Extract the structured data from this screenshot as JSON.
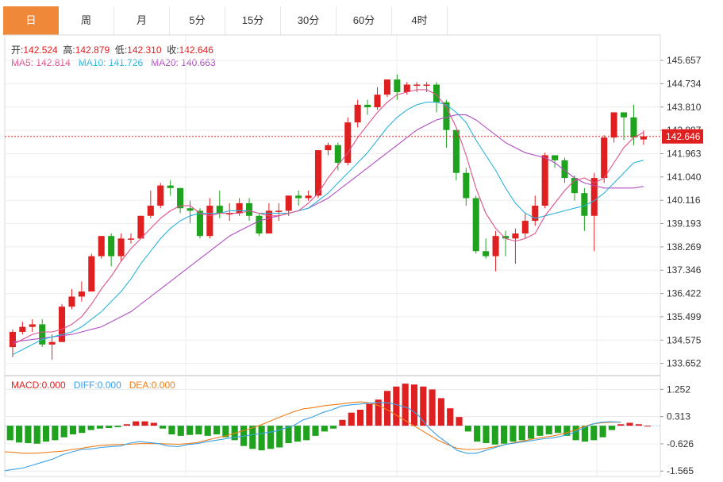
{
  "tabs": [
    {
      "label": "日",
      "active": true
    },
    {
      "label": "周"
    },
    {
      "label": "月"
    },
    {
      "label": "5分"
    },
    {
      "label": "15分"
    },
    {
      "label": "30分"
    },
    {
      "label": "60分"
    },
    {
      "label": "4时"
    }
  ],
  "ohlc_info": {
    "open_label": "开:",
    "open": "142.524",
    "high_label": "高:",
    "high": "142.879",
    "low_label": "低:",
    "low": "142.310",
    "close_label": "收:",
    "close": "142.646"
  },
  "ma_info": {
    "ma5_label": "MA5:",
    "ma5": "142.814",
    "ma10_label": "MA10:",
    "ma10": "141.726",
    "ma20_label": "MA20:",
    "ma20": "140.663"
  },
  "macd_info": {
    "macd_label": "MACD:",
    "macd": "0.000",
    "diff_label": "DIFF:",
    "diff": "0.000",
    "dea_label": "DEA:",
    "dea": "0.000"
  },
  "colors": {
    "up": "#e02020",
    "down": "#1fa31f",
    "ma5": "#e0508c",
    "ma10": "#2ab4d8",
    "ma20": "#b04ec2",
    "diff": "#3aa0e8",
    "dea": "#ef7d1a",
    "grid": "#ececec",
    "price_line": "#e02020"
  },
  "chart_data": [
    {
      "type": "candlestick",
      "ylim": [
        133.2,
        146.1
      ],
      "yticks": [
        "145.657",
        "144.734",
        "143.810",
        "142.887",
        "141.963",
        "141.040",
        "140.116",
        "139.193",
        "138.269",
        "137.346",
        "136.422",
        "135.499",
        "134.575",
        "133.652"
      ],
      "last_price": "142.646",
      "candles": [
        [
          134.3,
          134.9,
          135.0,
          133.9
        ],
        [
          134.9,
          135.1,
          135.3,
          134.8
        ],
        [
          135.1,
          135.2,
          135.4,
          134.9
        ],
        [
          135.2,
          134.4,
          135.4,
          134.3
        ],
        [
          134.4,
          134.5,
          134.8,
          133.8
        ],
        [
          134.5,
          135.9,
          136.0,
          134.5
        ],
        [
          135.9,
          136.3,
          136.6,
          135.8
        ],
        [
          136.3,
          136.5,
          136.9,
          136.1
        ],
        [
          136.5,
          137.9,
          138.0,
          136.5
        ],
        [
          137.9,
          138.7,
          138.7,
          137.8
        ],
        [
          138.7,
          137.9,
          138.8,
          137.5
        ],
        [
          137.9,
          138.6,
          138.8,
          137.7
        ],
        [
          138.6,
          138.6,
          138.8,
          138.4
        ],
        [
          138.6,
          139.5,
          139.5,
          138.6
        ],
        [
          139.5,
          139.9,
          140.5,
          139.4
        ],
        [
          139.9,
          140.7,
          140.8,
          139.8
        ],
        [
          140.7,
          140.6,
          140.9,
          140.3
        ],
        [
          140.6,
          139.8,
          140.6,
          139.6
        ],
        [
          139.8,
          139.7,
          140.1,
          139.2
        ],
        [
          139.7,
          138.7,
          139.8,
          138.6
        ],
        [
          138.7,
          139.9,
          140.2,
          138.6
        ],
        [
          139.9,
          139.6,
          140.5,
          139.4
        ],
        [
          139.6,
          139.6,
          140.0,
          139.3
        ],
        [
          139.6,
          140.0,
          140.2,
          139.5
        ],
        [
          140.0,
          139.5,
          140.2,
          139.3
        ],
        [
          139.5,
          138.8,
          139.6,
          138.7
        ],
        [
          138.8,
          139.7,
          140.0,
          138.8
        ],
        [
          139.7,
          139.7,
          140.0,
          139.3
        ],
        [
          139.7,
          140.3,
          140.3,
          139.5
        ],
        [
          140.3,
          140.2,
          140.5,
          139.9
        ],
        [
          140.2,
          140.3,
          140.5,
          140.1
        ],
        [
          140.3,
          142.1,
          142.1,
          140.2
        ],
        [
          142.1,
          142.3,
          142.4,
          141.9
        ],
        [
          142.3,
          141.6,
          142.4,
          141.3
        ],
        [
          141.6,
          143.2,
          143.4,
          141.5
        ],
        [
          143.2,
          143.9,
          144.1,
          143.0
        ],
        [
          143.9,
          143.8,
          144.1,
          143.5
        ],
        [
          143.8,
          144.3,
          144.6,
          143.7
        ],
        [
          144.3,
          144.9,
          144.9,
          144.2
        ],
        [
          144.9,
          144.4,
          145.1,
          144.1
        ],
        [
          144.4,
          144.7,
          144.8,
          144.3
        ],
        [
          144.7,
          144.7,
          144.8,
          144.4
        ],
        [
          144.7,
          144.7,
          144.8,
          144.4
        ],
        [
          144.7,
          144.0,
          144.8,
          143.6
        ],
        [
          144.0,
          142.9,
          144.1,
          142.2
        ],
        [
          142.9,
          141.2,
          142.9,
          140.9
        ],
        [
          141.2,
          140.2,
          141.4,
          139.9
        ],
        [
          140.2,
          138.1,
          140.3,
          138.0
        ],
        [
          138.1,
          137.9,
          138.6,
          137.8
        ],
        [
          137.9,
          138.7,
          138.9,
          137.3
        ],
        [
          138.7,
          138.6,
          138.9,
          137.9
        ],
        [
          138.6,
          138.8,
          139.0,
          137.6
        ],
        [
          138.8,
          139.3,
          139.6,
          138.6
        ],
        [
          139.3,
          139.9,
          140.3,
          139.1
        ],
        [
          139.9,
          141.9,
          142.0,
          139.8
        ],
        [
          141.9,
          141.7,
          141.9,
          141.4
        ],
        [
          141.7,
          141.0,
          141.8,
          140.8
        ],
        [
          141.0,
          140.4,
          141.1,
          140.1
        ],
        [
          140.4,
          139.5,
          140.6,
          138.9
        ],
        [
          139.5,
          141.0,
          141.2,
          138.1
        ],
        [
          141.0,
          142.6,
          142.7,
          140.8
        ],
        [
          142.6,
          143.6,
          143.6,
          142.4
        ],
        [
          143.6,
          143.4,
          143.6,
          142.5
        ],
        [
          143.4,
          142.6,
          143.9,
          142.3
        ],
        [
          142.524,
          142.646,
          142.879,
          142.31
        ]
      ],
      "ma5": [
        134.4,
        134.6,
        134.8,
        134.9,
        134.9,
        135.0,
        135.2,
        135.5,
        136.0,
        136.6,
        137.1,
        137.7,
        138.2,
        138.6,
        139.0,
        139.4,
        139.7,
        139.9,
        139.9,
        139.6,
        139.5,
        139.6,
        139.6,
        139.6,
        139.7,
        139.6,
        139.5,
        139.5,
        139.6,
        139.7,
        140.0,
        140.4,
        141.0,
        141.5,
        142.0,
        142.6,
        143.1,
        143.6,
        144.0,
        144.3,
        144.4,
        144.5,
        144.5,
        144.3,
        143.8,
        143.0,
        141.9,
        140.6,
        139.6,
        139.0,
        138.6,
        138.5,
        138.6,
        138.8,
        139.5,
        140.0,
        140.5,
        140.9,
        141.0,
        140.8,
        141.0,
        141.6,
        142.2,
        142.6,
        142.8
      ],
      "ma10": [
        134.0,
        134.2,
        134.4,
        134.6,
        134.7,
        134.8,
        134.9,
        135.1,
        135.4,
        135.7,
        136.1,
        136.5,
        137.0,
        137.6,
        138.1,
        138.6,
        139.0,
        139.3,
        139.5,
        139.6,
        139.6,
        139.6,
        139.7,
        139.7,
        139.7,
        139.6,
        139.6,
        139.6,
        139.6,
        139.7,
        139.8,
        140.1,
        140.4,
        140.8,
        141.2,
        141.6,
        142.0,
        142.5,
        143.0,
        143.4,
        143.7,
        143.9,
        144.0,
        144.0,
        143.9,
        143.6,
        143.2,
        142.5,
        141.9,
        141.3,
        140.6,
        140.0,
        139.6,
        139.4,
        139.5,
        139.6,
        139.7,
        139.8,
        139.9,
        140.1,
        140.4,
        140.8,
        141.2,
        141.6,
        141.7
      ],
      "ma20": [
        134.5,
        134.55,
        134.6,
        134.65,
        134.7,
        134.75,
        134.8,
        134.9,
        135.0,
        135.1,
        135.3,
        135.5,
        135.7,
        136.0,
        136.3,
        136.6,
        136.9,
        137.2,
        137.5,
        137.8,
        138.1,
        138.4,
        138.7,
        138.9,
        139.1,
        139.3,
        139.4,
        139.5,
        139.6,
        139.7,
        139.8,
        140.0,
        140.2,
        140.5,
        140.8,
        141.1,
        141.4,
        141.7,
        142.0,
        142.3,
        142.6,
        142.9,
        143.1,
        143.3,
        143.4,
        143.5,
        143.5,
        143.3,
        143.0,
        142.7,
        142.4,
        142.2,
        142.0,
        141.9,
        141.8,
        141.6,
        141.3,
        141.0,
        140.8,
        140.7,
        140.6,
        140.6,
        140.6,
        140.6,
        140.663
      ]
    },
    {
      "type": "macd",
      "ylim": [
        -1.75,
        1.7
      ],
      "yticks": [
        "1.252",
        "0.313",
        "-0.626",
        "-1.565"
      ],
      "hist": [
        -0.5,
        -0.58,
        -0.6,
        -0.62,
        -0.55,
        -0.5,
        -0.4,
        -0.3,
        -0.25,
        -0.15,
        -0.1,
        -0.08,
        -0.05,
        0.05,
        0.15,
        0.15,
        0.1,
        -0.1,
        -0.3,
        -0.35,
        -0.32,
        -0.3,
        -0.35,
        -0.3,
        -0.4,
        -0.5,
        -0.7,
        -0.8,
        -0.85,
        -0.8,
        -0.75,
        -0.6,
        -0.55,
        -0.5,
        -0.35,
        -0.2,
        -0.1,
        0.2,
        0.45,
        0.55,
        0.75,
        0.9,
        1.2,
        1.35,
        1.45,
        1.42,
        1.35,
        1.25,
        0.95,
        0.6,
        0.3,
        -0.2,
        -0.55,
        -0.6,
        -0.65,
        -0.62,
        -0.55,
        -0.5,
        -0.45,
        -0.35,
        -0.3,
        -0.25,
        -0.35,
        -0.5,
        -0.55,
        -0.5,
        -0.4,
        -0.15,
        0.05,
        0.1,
        0.05,
        0.0
      ],
      "diff": [
        -1.55,
        -1.5,
        -1.45,
        -1.35,
        -1.25,
        -1.15,
        -1.0,
        -0.9,
        -0.82,
        -0.8,
        -0.75,
        -0.72,
        -0.7,
        -0.6,
        -0.55,
        -0.58,
        -0.62,
        -0.7,
        -0.72,
        -0.65,
        -0.62,
        -0.55,
        -0.5,
        -0.45,
        -0.4,
        -0.35,
        -0.3,
        -0.25,
        -0.2,
        -0.1,
        0.0,
        0.2,
        0.3,
        0.45,
        0.55,
        0.68,
        0.72,
        0.75,
        0.78,
        0.8,
        0.78,
        0.7,
        0.6,
        0.35,
        -0.05,
        -0.35,
        -0.6,
        -0.85,
        -0.95,
        -0.95,
        -0.85,
        -0.75,
        -0.65,
        -0.6,
        -0.55,
        -0.5,
        -0.45,
        -0.42,
        -0.35,
        -0.25,
        -0.1,
        0.05,
        0.12,
        0.14,
        0.12
      ],
      "dea": [
        -0.9,
        -0.92,
        -0.95,
        -0.95,
        -0.93,
        -0.9,
        -0.88,
        -0.82,
        -0.78,
        -0.72,
        -0.68,
        -0.66,
        -0.65,
        -0.64,
        -0.62,
        -0.62,
        -0.62,
        -0.63,
        -0.64,
        -0.62,
        -0.58,
        -0.5,
        -0.42,
        -0.35,
        -0.25,
        -0.15,
        -0.05,
        0.08,
        0.22,
        0.35,
        0.48,
        0.58,
        0.62,
        0.68,
        0.72,
        0.75,
        0.8,
        0.82,
        0.78,
        0.68,
        0.5,
        0.3,
        0.1,
        -0.1,
        -0.3,
        -0.5,
        -0.65,
        -0.78,
        -0.82,
        -0.82,
        -0.78,
        -0.72,
        -0.65,
        -0.58,
        -0.52,
        -0.45,
        -0.4,
        -0.35,
        -0.28,
        -0.18,
        -0.05,
        0.05,
        0.1,
        0.12,
        0.12
      ]
    }
  ]
}
